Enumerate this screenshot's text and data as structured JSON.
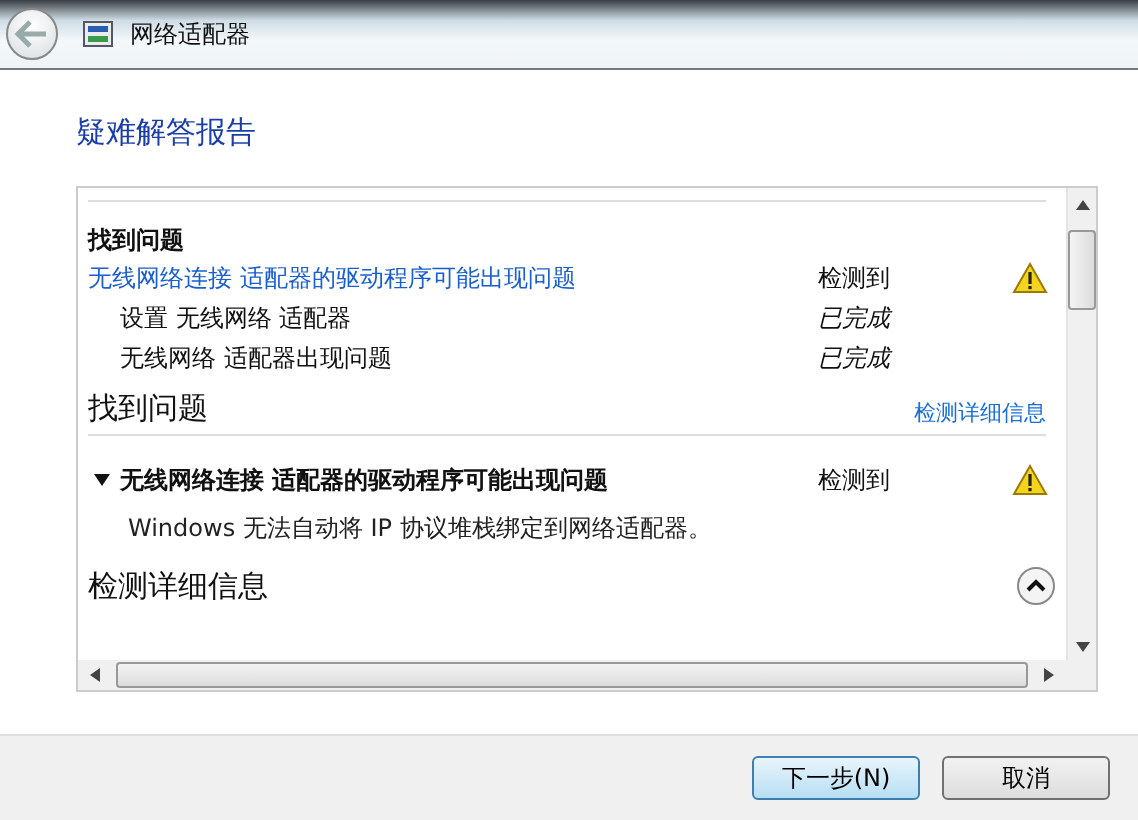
{
  "window": {
    "title": "网络适配器"
  },
  "heading": "疑难解答报告",
  "summary": {
    "title": "找到问题",
    "rows": [
      {
        "kind": "issue",
        "label": "无线网络连接 适配器的驱动程序可能出现问题",
        "status": "检测到"
      },
      {
        "kind": "step",
        "label": "设置 无线网络 适配器",
        "status": "已完成"
      },
      {
        "kind": "step",
        "label": "无线网络 适配器出现问题",
        "status": "已完成"
      }
    ]
  },
  "issues_section": {
    "title": "找到问题",
    "link": "检测详细信息",
    "issues": [
      {
        "label": "无线网络连接 适配器的驱动程序可能出现问题",
        "status": "检测到",
        "expanded": true,
        "description": "Windows 无法自动将 IP 协议堆栈绑定到网络适配器。"
      }
    ]
  },
  "details_section": {
    "title": "检测详细信息",
    "expanded": true
  },
  "buttons": [
    {
      "label": "下一步(N)",
      "default": true
    },
    {
      "label": "取消",
      "default": false
    }
  ]
}
